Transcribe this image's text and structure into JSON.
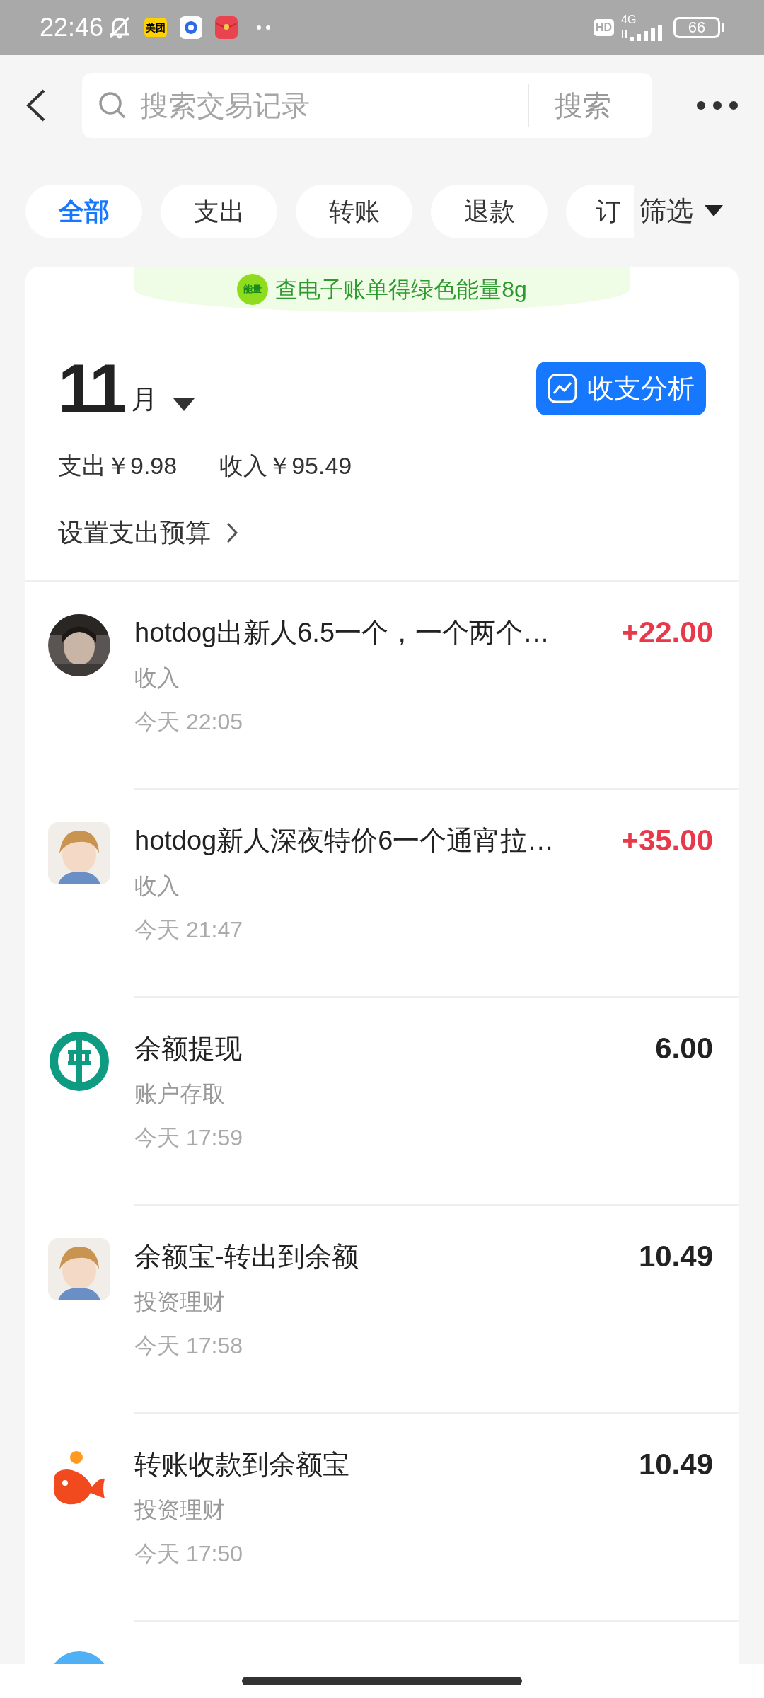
{
  "status_bar": {
    "time": "22:46",
    "hd": "HD",
    "network": "4G",
    "battery": "66",
    "app_badges": [
      {
        "kind": "meituan",
        "label": "美团"
      },
      {
        "kind": "circle"
      },
      {
        "kind": "redpacket"
      }
    ]
  },
  "search": {
    "placeholder": "搜索交易记录",
    "button": "搜索"
  },
  "filters": [
    {
      "label": "全部",
      "selected": true
    },
    {
      "label": "支出",
      "selected": false
    },
    {
      "label": "转账",
      "selected": false
    },
    {
      "label": "退款",
      "selected": false
    },
    {
      "label": "订",
      "selected": false
    }
  ],
  "filter_menu": "筛选",
  "banner": {
    "badge": "能量",
    "text": "查电子账单得绿色能量8g"
  },
  "month": {
    "number": "11",
    "unit": "月"
  },
  "analysis_button": "收支分析",
  "summary": {
    "expense": "支出￥9.98",
    "income": "收入￥95.49"
  },
  "budget_link": "设置支出预算",
  "transactions": [
    {
      "title": "hotdog出新人6.5一个，一个两个…",
      "category": "收入",
      "time": "今天 22:05",
      "amount": "+22.00",
      "income": true
    },
    {
      "kind": "cartoon",
      "title": "hotdog新人深夜特价6一个通宵拉…",
      "category": "收入",
      "time": "今天 21:47",
      "amount": "+35.00",
      "income": true
    },
    {
      "kind": "bank",
      "title": "余额提现",
      "category": "账户存取",
      "time": "今天 17:59",
      "amount": "6.00",
      "income": false
    },
    {
      "kind": "cartoon",
      "title": "余额宝-转出到余额",
      "category": "投资理财",
      "time": "今天 17:58",
      "amount": "10.49",
      "income": false
    },
    {
      "kind": "fish",
      "title": "转账收款到余额宝",
      "category": "投资理财",
      "time": "今天 17:50",
      "amount": "10.49",
      "income": false
    }
  ]
}
